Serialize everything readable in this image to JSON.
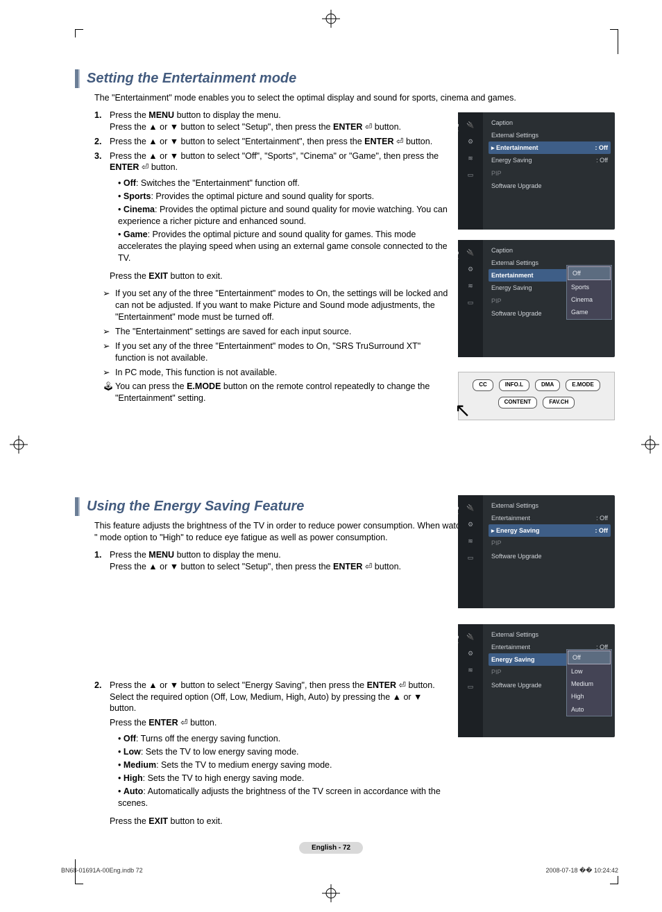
{
  "sec1": {
    "title": "Setting the Entertainment mode",
    "intro": "The \"Entertainment\" mode enables you to select the optimal display and sound for sports, cinema and games.",
    "s1a": "Press the ",
    "s1b": "MENU",
    "s1c": " button to display the menu.",
    "s1d": "Press the ▲ or ▼ button to select \"Setup\", then press the ",
    "s1e": "ENTER",
    "s1f": " button.",
    "s2a": "Press the ▲ or ▼ button to select \"Entertainment\", then press the ",
    "s2b": "ENTER",
    "s2c": " button.",
    "s3a": "Press the ▲ or ▼ button to select \"Off\", \"Sports\", \"Cinema\" or \"Game\", then press the ",
    "s3b": "ENTER",
    "s3c": " button.",
    "b_off_t": "Off",
    "b_off": ": Switches the \"Entertainment\" function off.",
    "b_spo_t": "Sports",
    "b_spo": ": Provides the optimal picture and sound quality for sports.",
    "b_cin_t": "Cinema",
    "b_cin": ": Provides the optimal picture and sound quality for movie watching. You can experience a richer picture and enhanced sound.",
    "b_gam_t": "Game",
    "b_gam": ": Provides the optimal picture and sound quality for games. This mode accelerates the playing speed when using an external game console connected to the TV.",
    "exit_a": "Press the ",
    "exit_b": "EXIT",
    "exit_c": " button to exit.",
    "n1": "If you set any of the three \"Entertainment\" modes to On, the settings will be locked and can not be adjusted. If you want to make Picture and Sound mode adjustments, the \"Entertainment\" mode must be turned off.",
    "n2": "The \"Entertainment\" settings are saved for each input source.",
    "n3": "If you set any of the three \"Entertainment\" modes to On, \"SRS TruSurround XT\" function is not available.",
    "n4": "In PC mode, This function is not available.",
    "n5a": "You can press the ",
    "n5b": "E.MODE",
    "n5c": " button on the remote control repeatedly to change the \"Entertainment\" setting."
  },
  "sec2": {
    "title": "Using the Energy Saving Feature",
    "intro": "This feature adjusts the brightness of the TV in order to reduce power consumption. When watching TV at night, set the \"Energy Saving \" mode option to \"High\" to reduce eye fatigue as well as power consumption.",
    "s1a": "Press the ",
    "s1b": "MENU",
    "s1c": " button to display the menu.",
    "s1d": "Press the ▲ or ▼ button to select \"Setup\", then press the ",
    "s1e": "ENTER",
    "s1f": " button.",
    "s2a": "Press the ▲ or ▼ button to select \"Energy Saving\", then press the ",
    "s2b": "ENTER",
    "s2c": " button. Select the required option (Off, Low, Medium, High, Auto) by pressing the ▲ or ▼ button.",
    "s2d": "Press the ",
    "s2e": "ENTER",
    "s2f": " button.",
    "b_off_t": "Off",
    "b_off": ": Turns off the energy saving function.",
    "b_low_t": "Low",
    "b_low": ": Sets the TV to low energy saving mode.",
    "b_med_t": "Medium",
    "b_med": ": Sets the TV to medium energy saving mode.",
    "b_hig_t": "High",
    "b_hig": ": Sets the TV to high energy saving mode.",
    "b_aut_t": "Auto",
    "b_aut": ": Automatically adjusts the brightness of the TV screen in accordance with the scenes.",
    "exit_a": "Press the ",
    "exit_b": "EXIT",
    "exit_c": " button to exit."
  },
  "osd": {
    "setup": "Setup",
    "caption": "Caption",
    "ext": "External Settings",
    "ent": "Entertainment",
    "ene": "Energy Saving",
    "pip": "PIP",
    "sw": "Software Upgrade",
    "off": ": Off",
    "d_off": "Off",
    "d_spo": "Sports",
    "d_cin": "Cinema",
    "d_gam": "Game",
    "e_off": "Off",
    "e_low": "Low",
    "e_med": "Medium",
    "e_hig": "High",
    "e_aut": "Auto"
  },
  "remote": {
    "cc": "CC",
    "info": "INFO.L",
    "dma": "DMA",
    "emode": "E.MODE",
    "content": "CONTENT",
    "fav": "FAV.CH"
  },
  "page": "English - 72",
  "footerL": "BN68-01691A-00Eng.indb   72",
  "footerR": "2008-07-18   �� 10:24:42"
}
